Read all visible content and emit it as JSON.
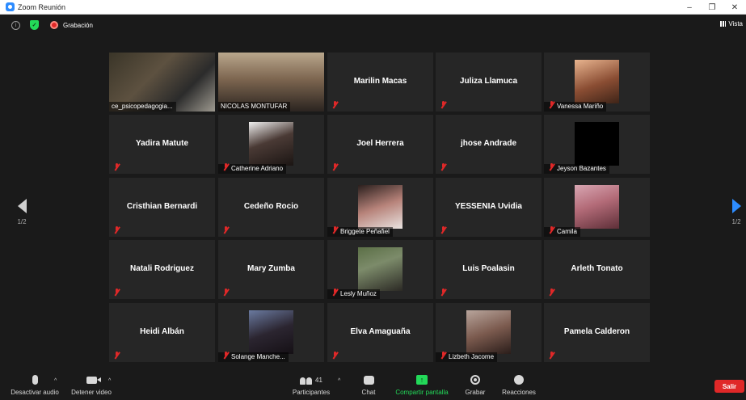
{
  "window": {
    "title": "Zoom Reunión",
    "minimize_glyph": "–",
    "restore_glyph": "❐",
    "close_glyph": "✕"
  },
  "topbar": {
    "recording_label": "Grabación",
    "view_label": "Vista",
    "info_glyph": "i",
    "shield_glyph": "✓"
  },
  "navigation": {
    "page_indicator_left": "1/2",
    "page_indicator_right": "1/2"
  },
  "participants": [
    {
      "name": "ce_psicopedagogia...",
      "video": true,
      "active_speaker": true,
      "muted": false
    },
    {
      "name": "NICOLAS MONTUFAR",
      "video": true,
      "muted": false
    },
    {
      "name": "Marilin Macas",
      "video": false,
      "muted": true
    },
    {
      "name": "Juliza Llamuca",
      "video": false,
      "muted": true
    },
    {
      "name": "Vanessa Mariño",
      "video": true,
      "muted": true
    },
    {
      "name": "Yadira Matute",
      "video": false,
      "muted": true
    },
    {
      "name": "Catherine Adriano",
      "video": true,
      "muted": true
    },
    {
      "name": "Joel Herrera",
      "video": false,
      "muted": true
    },
    {
      "name": "jhose Andrade",
      "video": false,
      "muted": true
    },
    {
      "name": "Jeyson Bazantes",
      "video": true,
      "muted": true
    },
    {
      "name": "Cristhian Bernardi",
      "video": false,
      "muted": true
    },
    {
      "name": "Cedeño Rocio",
      "video": false,
      "muted": true
    },
    {
      "name": "Briggete Peñafiel",
      "video": true,
      "muted": true
    },
    {
      "name": "YESSENIA Uvidia",
      "video": false,
      "muted": true
    },
    {
      "name": "Camila",
      "video": true,
      "muted": true
    },
    {
      "name": "Natali Rodriguez",
      "video": false,
      "muted": true
    },
    {
      "name": "Mary Zumba",
      "video": false,
      "muted": true
    },
    {
      "name": "Lesly Muñoz",
      "video": true,
      "muted": true
    },
    {
      "name": "Luis Poalasin",
      "video": false,
      "muted": true
    },
    {
      "name": "Arleth Tonato",
      "video": false,
      "muted": true
    },
    {
      "name": "Heidi Albán",
      "video": false,
      "muted": true
    },
    {
      "name": "Solange Manche...",
      "video": true,
      "muted": true
    },
    {
      "name": "Elva Amaguaña",
      "video": false,
      "muted": true
    },
    {
      "name": "Lizbeth Jacome",
      "video": true,
      "muted": true
    },
    {
      "name": "Pamela Calderon",
      "video": false,
      "muted": true
    }
  ],
  "toolbar": {
    "mute_label": "Desactivar audio",
    "video_label": "Detener video",
    "participants_label": "Participantes",
    "participants_count": "41",
    "chat_label": "Chat",
    "share_label": "Compartir pantalla",
    "share_glyph": "↑",
    "record_label": "Grabar",
    "reactions_label": "Reacciones",
    "leave_label": "Salir",
    "caret_glyph": "^"
  },
  "colors": {
    "background": "#1a1a1a",
    "tile": "#262626",
    "active_speaker_border": "#b9e36b",
    "muted_red": "#e02828",
    "share_green": "#23d959",
    "nav_blue": "#2d8cff"
  },
  "icons": [
    "zoom-app-icon",
    "info-icon",
    "shield-icon",
    "recording-icon",
    "gallery-view-icon",
    "mic-muted-icon",
    "microphone-icon",
    "camera-icon",
    "participants-icon",
    "chat-icon",
    "share-screen-icon",
    "record-icon",
    "reactions-icon",
    "chevron-left-icon",
    "chevron-right-icon"
  ]
}
